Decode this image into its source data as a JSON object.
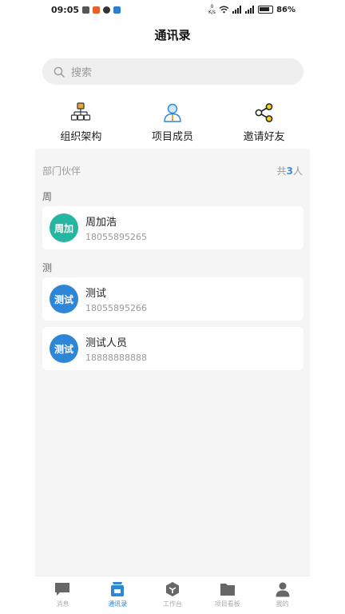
{
  "status_bar": {
    "time": "09:05",
    "net_speed_value": "0",
    "net_speed_unit": "K/s",
    "battery": "86%"
  },
  "header": {
    "title": "通讯录"
  },
  "search": {
    "placeholder": "搜索"
  },
  "actions": [
    {
      "label": "组织架构",
      "icon": "org-chart-icon"
    },
    {
      "label": "项目成员",
      "icon": "person-icon"
    },
    {
      "label": "邀请好友",
      "icon": "share-icon"
    }
  ],
  "list": {
    "section_label": "部门伙伴",
    "count_prefix": "共",
    "count_value": "3",
    "count_suffix": "人",
    "groups": [
      {
        "letter": "周",
        "contacts": [
          {
            "avatar_text": "周加",
            "name": "周加浩",
            "phone": "18055895265",
            "avatar_color": "#26b5a0"
          }
        ]
      },
      {
        "letter": "测",
        "contacts": [
          {
            "avatar_text": "测试",
            "name": "测试",
            "phone": "18055895266",
            "avatar_color": "#2f86d6"
          },
          {
            "avatar_text": "测试",
            "name": "测试人员",
            "phone": "18888888888",
            "avatar_color": "#2f86d6"
          }
        ]
      }
    ]
  },
  "bottom_nav": [
    {
      "label": "消息",
      "icon": "chat-icon",
      "active": false
    },
    {
      "label": "通讯录",
      "icon": "contacts-icon",
      "active": true
    },
    {
      "label": "工作台",
      "icon": "workbench-icon",
      "active": false
    },
    {
      "label": "项目看板",
      "icon": "folder-icon",
      "active": false
    },
    {
      "label": "我的",
      "icon": "profile-icon",
      "active": false
    }
  ],
  "colors": {
    "accent": "#2f86d6",
    "teal_avatar": "#26b5a0",
    "org_icon": "#e8a33a",
    "share_icon": "#f2d21a"
  }
}
